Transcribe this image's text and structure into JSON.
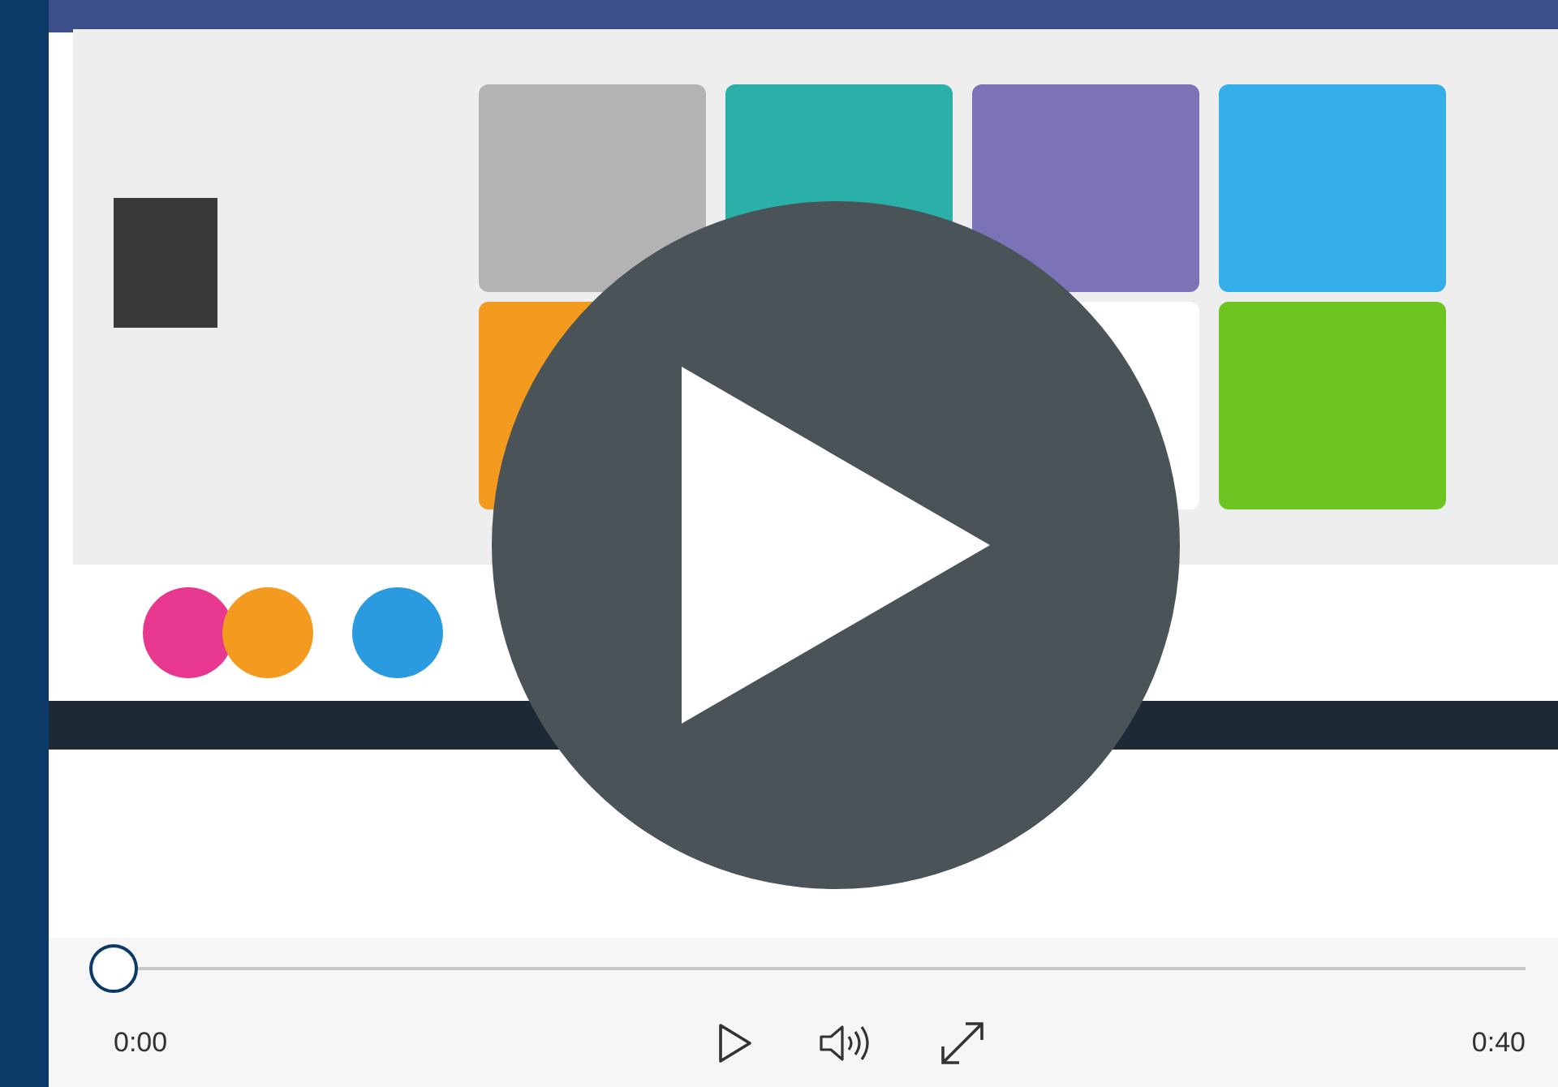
{
  "progress": {
    "level": 0
  },
  "controls": {
    "current_time": "0:00",
    "duration": "0:40"
  }
}
